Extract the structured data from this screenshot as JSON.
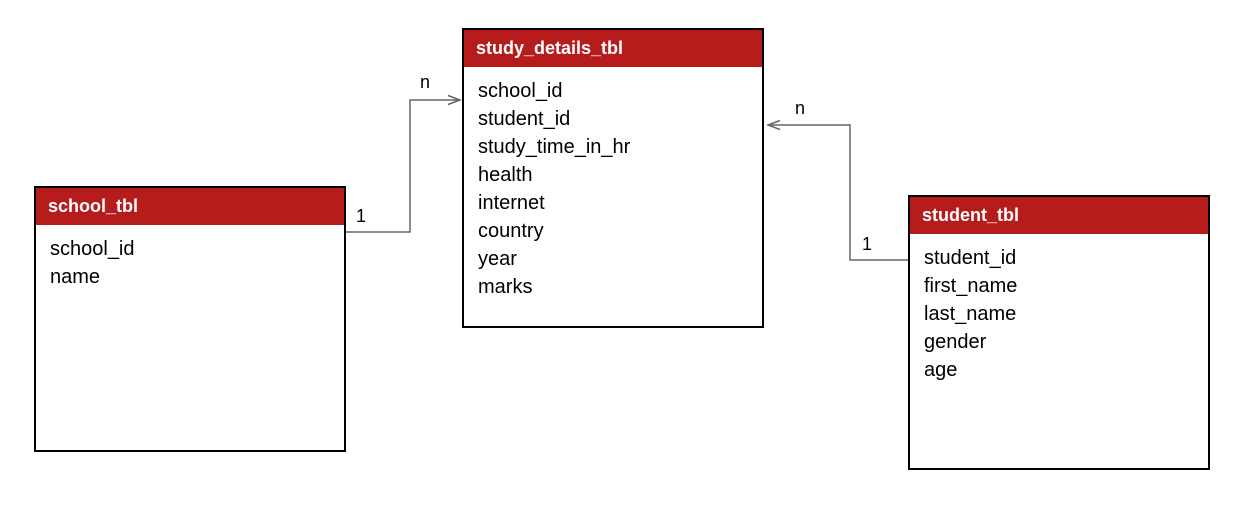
{
  "entities": {
    "school": {
      "title": "school_tbl",
      "fields": [
        "school_id",
        "name"
      ]
    },
    "study_details": {
      "title": "study_details_tbl",
      "fields": [
        "school_id",
        "student_id",
        "study_time_in_hr",
        "health",
        "internet",
        "country",
        "year",
        "marks"
      ]
    },
    "student": {
      "title": "student_tbl",
      "fields": [
        "student_id",
        "first_name",
        "last_name",
        "gender",
        "age"
      ]
    }
  },
  "relationships": {
    "school_to_study": {
      "left_cardinality": "1",
      "right_cardinality": "n"
    },
    "student_to_study": {
      "left_cardinality": "n",
      "right_cardinality": "1"
    }
  }
}
